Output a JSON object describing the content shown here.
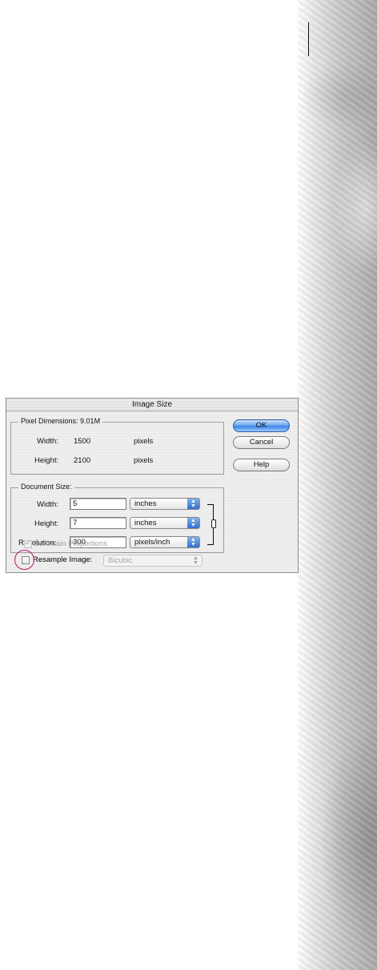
{
  "dialog": {
    "title": "Image Size",
    "pixel_dimensions": {
      "label": "Pixel Dimensions:",
      "size": "9.01M",
      "width_label": "Width:",
      "width_value": "1500",
      "width_unit": "pixels",
      "height_label": "Height:",
      "height_value": "2100",
      "height_unit": "pixels"
    },
    "document_size": {
      "label": "Document Size:",
      "width_label": "Width:",
      "width_value": "5",
      "width_unit": "inches",
      "height_label": "Height:",
      "height_value": "7",
      "height_unit": "inches",
      "resolution_label": "Resolution:",
      "resolution_value": "300",
      "resolution_unit": "pixels/inch"
    },
    "buttons": {
      "ok": "OK",
      "cancel": "Cancel",
      "help": "Help"
    },
    "constrain_proportions": {
      "label": "Constrain Proportions",
      "checked": true,
      "enabled": false
    },
    "resample": {
      "label": "Resample Image:",
      "checked": false,
      "method": "Bicubic"
    }
  },
  "colors": {
    "highlight_circle": "#c0176c",
    "default_button": "#3f86e6",
    "popup_arrows": "#2f6fd1"
  },
  "icons": [
    "popup-arrows-icon",
    "chain-link-icon",
    "checkmark-icon"
  ]
}
